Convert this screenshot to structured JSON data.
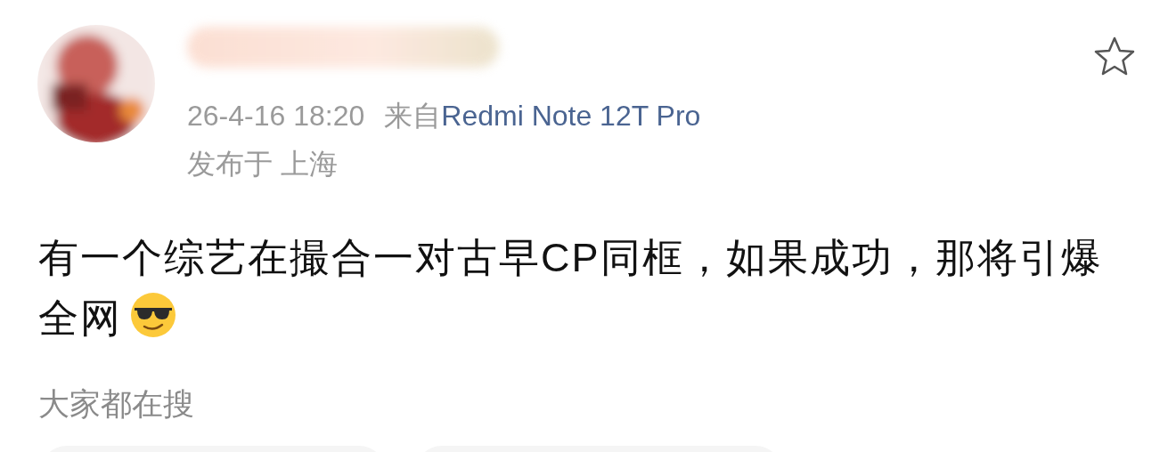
{
  "post": {
    "time": "26-4-16 18:20",
    "source_prefix": "来自",
    "source": "Redmi Note 12T Pro",
    "location": "发布于 上海",
    "text": "有一个综艺在撮合一对古早CP同框，如果成功，那将引爆全网",
    "favorited": false
  },
  "section_title": "大家都在搜",
  "search_cards": [
    {
      "kind": "card"
    },
    {
      "kind": "card"
    }
  ]
}
